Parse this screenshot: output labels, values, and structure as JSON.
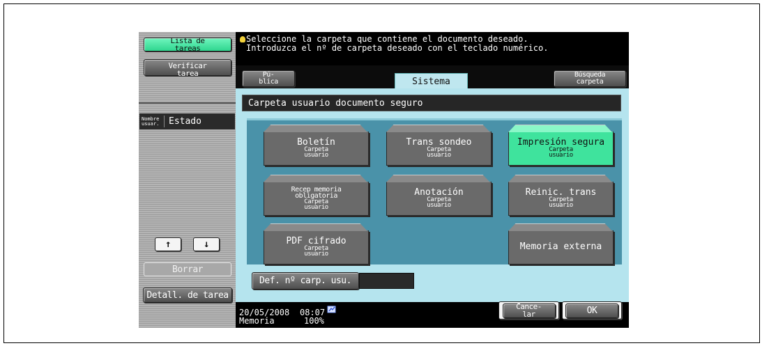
{
  "sidebar": {
    "lista_line1": "Lista de",
    "lista_line2": "tareas",
    "verificar_line1": "Verificar",
    "verificar_line2": "tarea",
    "nombre_line1": "Nombre",
    "nombre_line2": "usuar.",
    "estado_label": "Estado",
    "up_arrow": "↑",
    "down_arrow": "↓",
    "borrar_label": "Borrar",
    "detalle_label": "Detall. de tarea"
  },
  "message": {
    "line1": "Seleccione la carpeta que contiene el documento deseado.",
    "line2": "Introduzca el nº de carpeta deseado con el teclado numérico."
  },
  "tabs": {
    "publica_line1": "Pú-",
    "publica_line2": "blica",
    "sistema": "Sistema",
    "busqueda_line1": "Búsqueda",
    "busqueda_line2": "carpeta"
  },
  "header_title": "Carpeta usuario documento seguro",
  "folders": {
    "boletin": {
      "title": "Boletín",
      "sub1": "Carpeta",
      "sub2": "usuario"
    },
    "trans_sondeo": {
      "title": "Trans sondeo",
      "sub1": "Carpeta",
      "sub2": "usuario"
    },
    "impresion_segura": {
      "title": "Impresión segura",
      "sub1": "Carpeta",
      "sub2": "usuario"
    },
    "recep_memoria": {
      "title1": "Recep memoria",
      "title2": "obligatoria",
      "sub1": "Carpeta",
      "sub2": "usuario"
    },
    "anotacion": {
      "title": "Anotación",
      "sub1": "Carpeta",
      "sub2": "usuario"
    },
    "reinic_trans": {
      "title": "Reinic. trans",
      "sub1": "Carpeta",
      "sub2": "usuario"
    },
    "pdf_cifrado": {
      "title": "PDF cifrado",
      "sub1": "Carpeta",
      "sub2": "usuario"
    },
    "memoria_externa": {
      "title": "Memoria externa"
    }
  },
  "def_label": "Def. nº carp. usu.",
  "status": {
    "date": "20/05/2008",
    "time": "08:07",
    "memory_label": "Memoria",
    "memory_value": "100%"
  },
  "actions": {
    "cancel_line1": "Cance-",
    "cancel_line2": "lar",
    "ok": "OK"
  },
  "colors": {
    "accent_green": "#3fe39d",
    "panel_blue": "#b5e4ee",
    "inner_blue": "#4a92a9"
  }
}
